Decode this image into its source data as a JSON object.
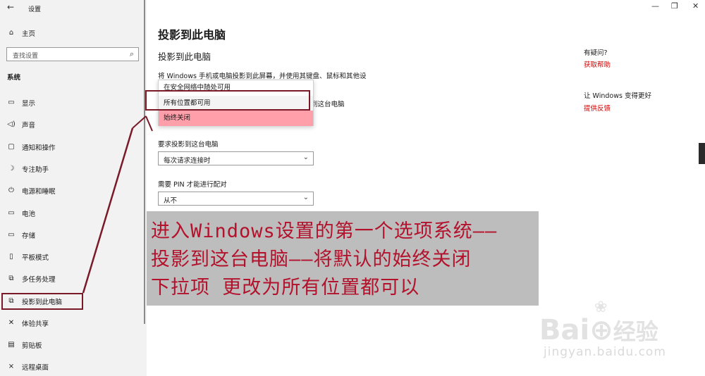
{
  "window": {
    "title": "设置",
    "back_icon": "arrow-left-icon",
    "controls": [
      "—",
      "❐",
      "✕"
    ]
  },
  "sidebar": {
    "home_label": "主页",
    "search_placeholder": "查找设置",
    "category": "系统",
    "items": [
      {
        "label": "显示",
        "icon": "monitor-icon",
        "glyph": "▭"
      },
      {
        "label": "声音",
        "icon": "speaker-icon",
        "glyph": "🔈"
      },
      {
        "label": "通知和操作",
        "icon": "notification-icon",
        "glyph": "▢"
      },
      {
        "label": "专注助手",
        "icon": "moon-icon",
        "glyph": "☽"
      },
      {
        "label": "电源和睡眠",
        "icon": "power-icon",
        "glyph": "⏻"
      },
      {
        "label": "电池",
        "icon": "battery-icon",
        "glyph": "▭"
      },
      {
        "label": "存储",
        "icon": "storage-icon",
        "glyph": "▭"
      },
      {
        "label": "平板模式",
        "icon": "tablet-icon",
        "glyph": "▯"
      },
      {
        "label": "多任务处理",
        "icon": "multitask-icon",
        "glyph": "⧉"
      },
      {
        "label": "投影到此电脑",
        "icon": "project-icon",
        "glyph": "⧉",
        "selected": true
      },
      {
        "label": "体验共享",
        "icon": "share-icon",
        "glyph": "✕"
      },
      {
        "label": "剪贴板",
        "icon": "clipboard-icon",
        "glyph": "▤"
      },
      {
        "label": "远程桌面",
        "icon": "remote-icon",
        "glyph": "⨯"
      }
    ]
  },
  "main": {
    "title": "投影到此电脑",
    "section": "投影到此电脑",
    "description": "将 Windows 手机或电脑投影到此屏幕，并使用其键盘、鼠标和其他设",
    "partial_text": "到这台电脑",
    "popup_options": [
      "在安全网络中随处可用",
      "所有位置都可用",
      "始终关闭"
    ],
    "request_label": "要求投影到这台电脑",
    "request_value": "每次请求连接时",
    "pin_label": "需要 PIN 才能进行配对",
    "pin_value": "从不"
  },
  "right": {
    "q_heading": "有疑问?",
    "q_link": "获取帮助",
    "better_heading": "让 Windows 变得更好",
    "feedback_link": "提供反馈"
  },
  "caption": {
    "line1": "进入Windows设置的第一个选项系统——",
    "line2": "投影到这台电脑——将默认的始终关闭",
    "line3": "下拉项 更改为所有位置都可以"
  },
  "watermark": {
    "line1": "Bai",
    "line2": "经验",
    "url": "jingyan.baidu.com"
  },
  "colors": {
    "annotation": "#7a1a28",
    "link": "#d00000",
    "selected_option": "#ff9faa",
    "caption_text": "#b3122c",
    "caption_bg": "#bdbdbd"
  }
}
